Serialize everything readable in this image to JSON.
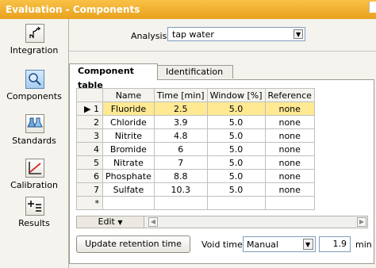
{
  "window": {
    "title": "Evaluation - Components"
  },
  "sidebar": {
    "items": [
      {
        "label": "Integration",
        "icon": "integration-icon"
      },
      {
        "label": "Components",
        "icon": "components-icon",
        "active": true
      },
      {
        "label": "Standards",
        "icon": "standards-icon"
      },
      {
        "label": "Calibration",
        "icon": "calibration-icon"
      },
      {
        "label": "Results",
        "icon": "results-icon"
      }
    ]
  },
  "analysis": {
    "label": "Analysis",
    "value": "tap water"
  },
  "tabs": {
    "component_table": "Component table",
    "identification": "Identification"
  },
  "table": {
    "headers": [
      "Name",
      "Time [min]",
      "Window [%]",
      "Reference"
    ],
    "rows": [
      {
        "index": "1",
        "name": "Fluoride",
        "time": "2.5",
        "window": "5.0",
        "reference": "none",
        "selected": true
      },
      {
        "index": "2",
        "name": "Chloride",
        "time": "3.9",
        "window": "5.0",
        "reference": "none"
      },
      {
        "index": "3",
        "name": "Nitrite",
        "time": "4.8",
        "window": "5.0",
        "reference": "none"
      },
      {
        "index": "4",
        "name": "Bromide",
        "time": "6",
        "window": "5.0",
        "reference": "none"
      },
      {
        "index": "5",
        "name": "Nitrate",
        "time": "7",
        "window": "5.0",
        "reference": "none"
      },
      {
        "index": "6",
        "name": "Phosphate",
        "time": "8.8",
        "window": "5.0",
        "reference": "none"
      },
      {
        "index": "7",
        "name": "Sulfate",
        "time": "10.3",
        "window": "5.0",
        "reference": "none"
      }
    ],
    "new_row_marker": "*"
  },
  "toolbar": {
    "edit_label": "Edit"
  },
  "bottom": {
    "update_label": "Update retention time",
    "void_time_label": "Void time",
    "mode_value": "Manual",
    "void_value": "1.9",
    "unit": "min"
  }
}
